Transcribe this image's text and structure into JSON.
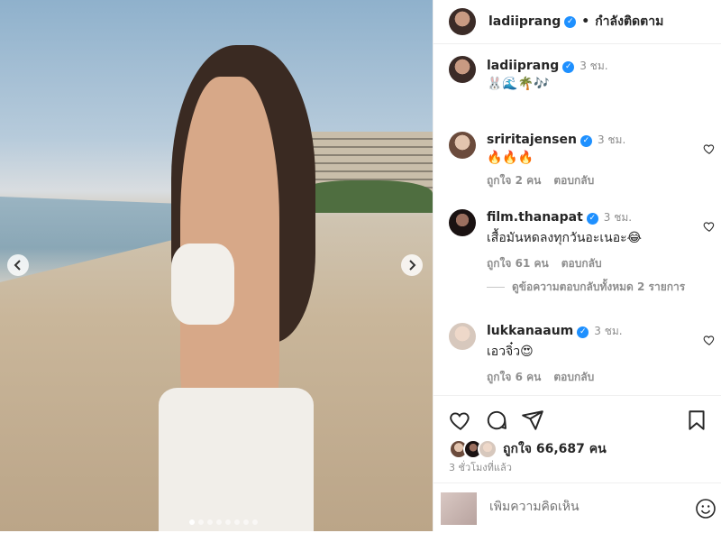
{
  "post": {
    "image_alt": "Woman in white outfit on a beach",
    "carousel_dots": 8,
    "active_dot": 1
  },
  "header": {
    "username": "ladiiprang",
    "separator": "•",
    "follow_label": "กำลังติดตาม"
  },
  "caption": {
    "username": "ladiiprang",
    "time": "3 ชม.",
    "text": "🐰🌊🌴🎶"
  },
  "comments": [
    {
      "username": "sriritajensen",
      "time": "3 ชม.",
      "text": "🔥🔥🔥",
      "likes": "ถูกใจ 2 คน",
      "reply": "ตอบกลับ"
    },
    {
      "username": "film.thanapat",
      "time": "3 ชม.",
      "text": "เสื้อมันหดลงทุกวันอะเนอะ😂",
      "likes": "ถูกใจ 61 คน",
      "reply": "ตอบกลับ"
    },
    {
      "username": "lukkanaaum",
      "time": "3 ชม.",
      "text": "เอวจิ๋ว😍",
      "likes": "ถูกใจ 6 คน",
      "reply": "ตอบกลับ"
    }
  ],
  "view_replies": "ดูข้อความตอบกลับทั้งหมด 2 รายการ",
  "actions": {
    "likes_count": "ถูกใจ 66,687 คน",
    "time_ago": "3 ชั่วโมงที่แล้ว",
    "add_comment_placeholder": "เพิ่มความคิดเห็น"
  }
}
